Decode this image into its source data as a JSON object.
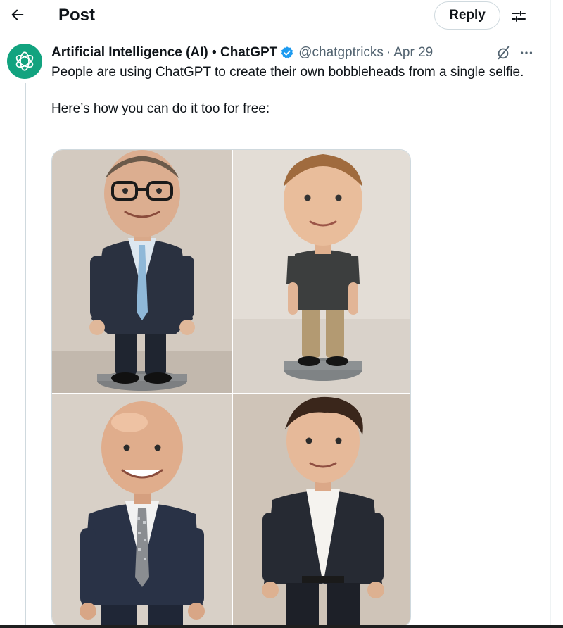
{
  "header": {
    "title": "Post",
    "reply_label": "Reply"
  },
  "post": {
    "author_name": "Artificial Intelligence (AI) • ChatGPT",
    "handle": "@chatgptricks",
    "separator": "·",
    "date": "Apr 29",
    "text_line1": "People are using ChatGPT to create their own bobbleheads from a single selfie.",
    "text_line2": "Here’s how you can do it too for free:",
    "verified": true,
    "media_count": 4
  },
  "colors": {
    "avatar_bg": "#12a37f",
    "verified_blue": "#1d9bf0",
    "secondary_text": "#536471"
  },
  "icons": {
    "back": "arrow-left-icon",
    "tune": "sliders-icon",
    "verified": "verified-badge-icon",
    "grok": "grok-icon",
    "more": "more-icon",
    "avatar": "openai-logo-icon"
  }
}
